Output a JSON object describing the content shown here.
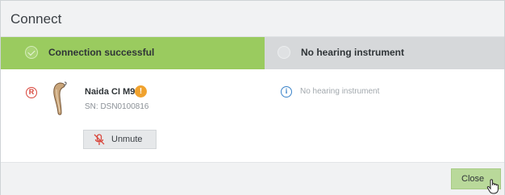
{
  "window": {
    "title": "Connect"
  },
  "status": {
    "left": {
      "label": "Connection successful",
      "icon": "check-circle-icon",
      "color": "#9acb5f"
    },
    "right": {
      "label": "No hearing instrument",
      "icon": "empty-circle-icon",
      "color": "#d6d8da"
    }
  },
  "device": {
    "side": "R",
    "name": "Naida CI M90",
    "warning_symbol": "!",
    "serial": "SN: DSN0100816",
    "unmute_label": "Unmute"
  },
  "right_panel": {
    "info_symbol": "i",
    "text": "No hearing instrument"
  },
  "footer": {
    "close_label": "Close"
  },
  "colors": {
    "accent_green": "#9acb5f",
    "side_red": "#d8453b",
    "warning_orange": "#f0a22e",
    "info_blue": "#3a83c9"
  }
}
